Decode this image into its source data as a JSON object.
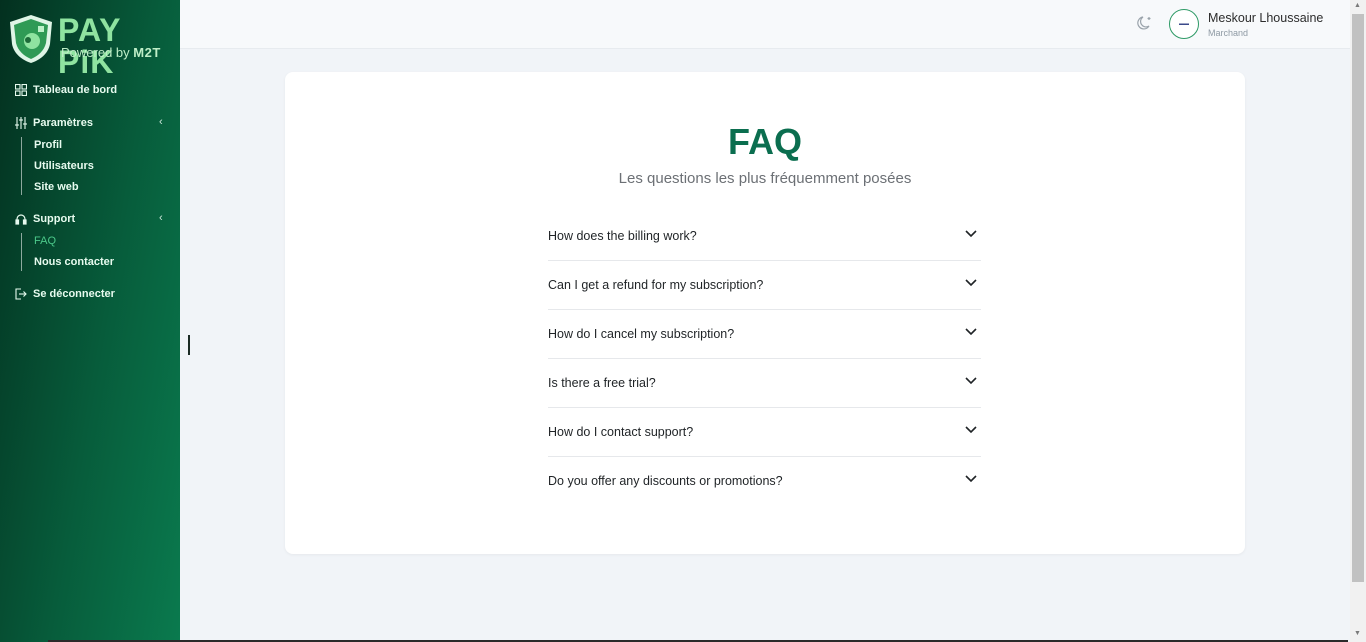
{
  "brand": {
    "logo_text": "PAY PiK",
    "powered_label": "Powered by",
    "powered_brand": "M2T"
  },
  "sidebar": {
    "dashboard": {
      "label": "Tableau de bord",
      "icon": "grid-icon"
    },
    "settings": {
      "label": "Paramètres",
      "icon": "sliders-icon",
      "items": [
        "Profil",
        "Utilisateurs",
        "Site web"
      ]
    },
    "support": {
      "label": "Support",
      "icon": "headset-icon",
      "items": [
        "FAQ",
        "Nous contacter"
      ],
      "active": "FAQ"
    },
    "logout": {
      "label": "Se déconnecter",
      "icon": "logout-icon"
    }
  },
  "header": {
    "theme_icon": "moon-icon",
    "user_name": "Meskour Lhoussaine",
    "user_role": "Marchand"
  },
  "faq": {
    "title": "FAQ",
    "subtitle": "Les questions les plus fréquemment posées",
    "questions": [
      "How does the billing work?",
      "Can I get a refund for my subscription?",
      "How do I cancel my subscription?",
      "Is there a free trial?",
      "How do I contact support?",
      "Do you offer any discounts or promotions?"
    ]
  },
  "colors": {
    "accent": "#0b6e4f",
    "sidebar_dark": "#03301f",
    "sidebar_light": "#0a7a4e",
    "active_sub": "#4cc98a"
  }
}
